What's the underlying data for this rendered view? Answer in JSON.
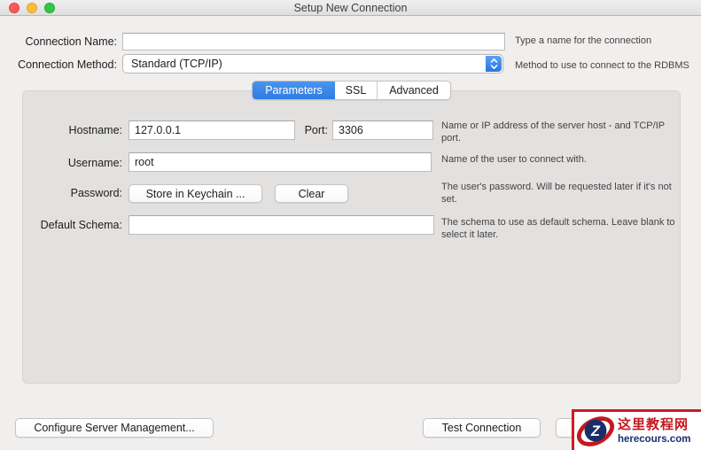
{
  "window": {
    "title": "Setup New Connection"
  },
  "header_fields": {
    "connection_name": {
      "label": "Connection Name:",
      "value": "",
      "hint": "Type a name for the connection"
    },
    "connection_method": {
      "label": "Connection Method:",
      "value": "Standard (TCP/IP)",
      "hint": "Method to use to connect to the RDBMS"
    }
  },
  "tabs": [
    {
      "label": "Parameters",
      "selected": true
    },
    {
      "label": "SSL",
      "selected": false
    },
    {
      "label": "Advanced",
      "selected": false
    }
  ],
  "parameters": {
    "hostname": {
      "label": "Hostname:",
      "value": "127.0.0.1"
    },
    "port": {
      "label": "Port:",
      "value": "3306"
    },
    "hostname_hint": "Name or IP address of the server host - and TCP/IP port.",
    "username": {
      "label": "Username:",
      "value": "root",
      "hint": "Name of the user to connect with."
    },
    "password": {
      "label": "Password:",
      "store_button": "Store in Keychain ...",
      "clear_button": "Clear",
      "hint": "The user's password. Will be requested later if it's not set."
    },
    "default_schema": {
      "label": "Default Schema:",
      "value": "",
      "hint": "The schema to use as default schema. Leave blank to select it later."
    }
  },
  "footer": {
    "configure_button": "Configure Server Management...",
    "test_button": "Test Connection"
  },
  "watermark": {
    "cn_text": "这里教程网",
    "site_text": "herecours.com",
    "logo_letter": "Z"
  },
  "colors": {
    "accent_blue": "#3583e6",
    "watermark_red": "#c41820",
    "watermark_navy": "#16316e",
    "traffic_red": "#fc5b57",
    "traffic_yellow": "#fdbc40",
    "traffic_green": "#33c748"
  }
}
